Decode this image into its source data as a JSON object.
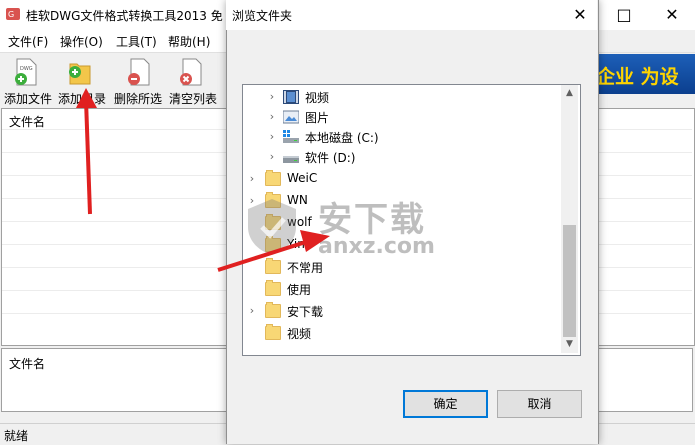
{
  "app": {
    "title": "桂软DWG文件格式转换工具2013 免",
    "menus": [
      "文件(F)",
      "操作(O)",
      "工具(T)",
      "帮助(H)"
    ],
    "toolbar": [
      {
        "label": "添加文件",
        "icon": "add-file-icon"
      },
      {
        "label": "添加目录",
        "icon": "add-folder-icon"
      },
      {
        "label": "删除所选",
        "icon": "delete-selected-icon"
      },
      {
        "label": "清空列表",
        "icon": "clear-list-icon"
      }
    ],
    "banner_text": "企业  为设",
    "list_top_header": "文件名",
    "list_bottom_header": "文件名",
    "status": "就绪"
  },
  "dialog": {
    "title": "浏览文件夹",
    "ok_label": "确定",
    "cancel_label": "取消",
    "tree": [
      {
        "label": "视频",
        "icon": "video-folder-icon",
        "expandable": true,
        "level": 1
      },
      {
        "label": "图片",
        "icon": "picture-folder-icon",
        "expandable": true,
        "level": 1
      },
      {
        "label": "本地磁盘 (C:)",
        "icon": "system-drive-icon",
        "expandable": true,
        "level": 1
      },
      {
        "label": "软件 (D:)",
        "icon": "drive-icon",
        "expandable": true,
        "level": 1
      },
      {
        "label": "WeiC",
        "icon": "folder-icon",
        "expandable": true,
        "level": 0
      },
      {
        "label": "WN",
        "icon": "folder-icon",
        "expandable": true,
        "level": 0
      },
      {
        "label": "wolf",
        "icon": "folder-icon",
        "expandable": false,
        "level": 0
      },
      {
        "label": "Yin",
        "icon": "folder-icon",
        "expandable": false,
        "level": 0
      },
      {
        "label": "不常用",
        "icon": "folder-icon",
        "expandable": false,
        "level": 0
      },
      {
        "label": "使用",
        "icon": "folder-icon",
        "expandable": false,
        "level": 0
      },
      {
        "label": "安下载",
        "icon": "folder-icon",
        "expandable": true,
        "level": 0
      },
      {
        "label": "视频",
        "icon": "folder-icon",
        "expandable": false,
        "level": 0
      }
    ]
  },
  "watermark": {
    "text": "安下载",
    "sub": "anxz.com"
  }
}
